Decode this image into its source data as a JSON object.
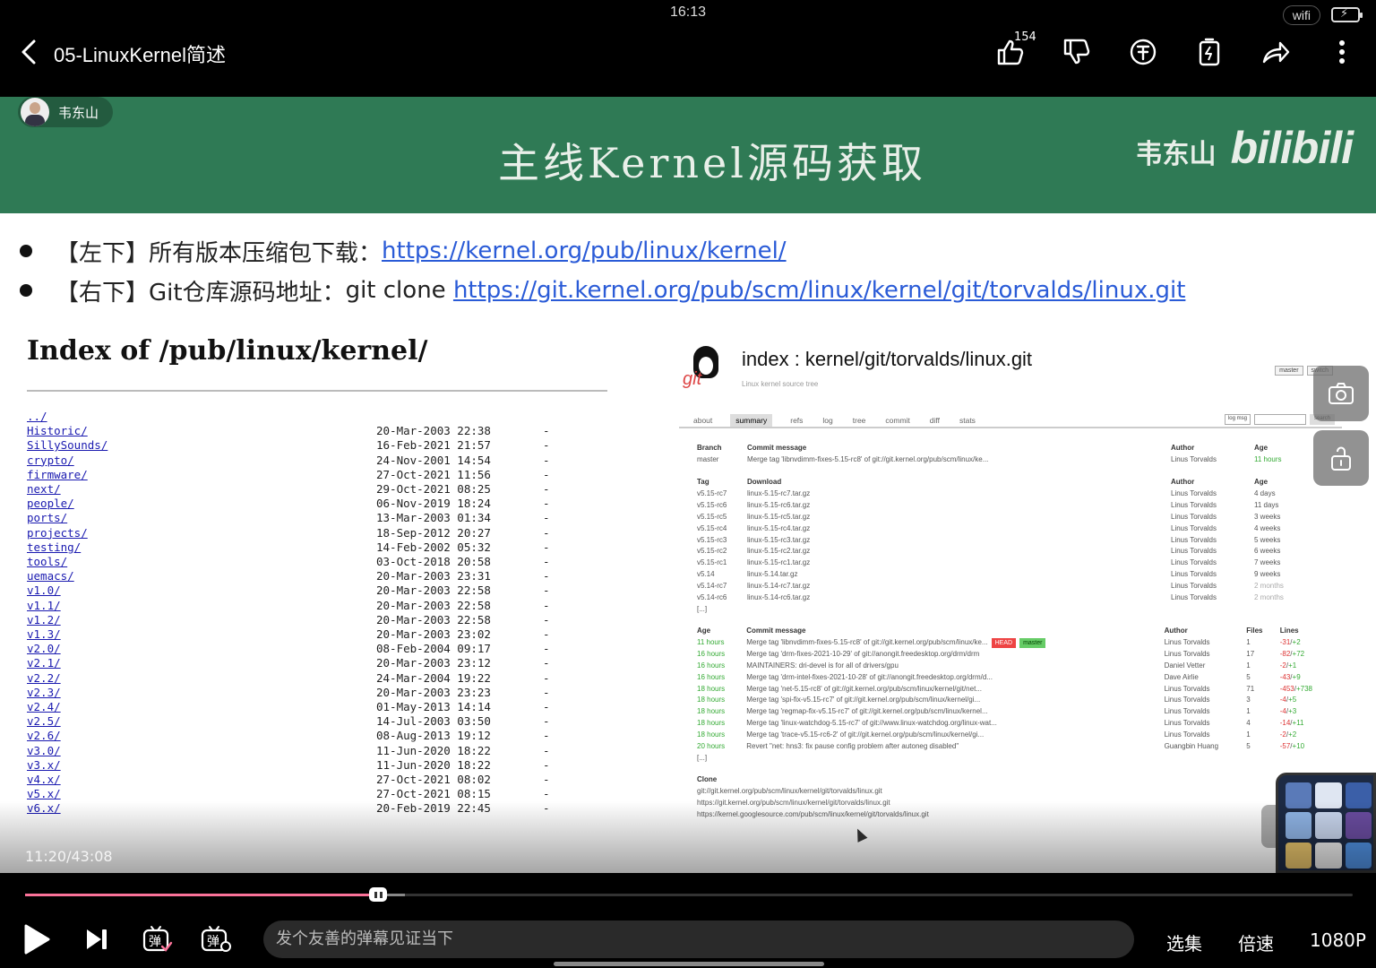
{
  "status_bar": {
    "time": "16:13",
    "wifi": "wifi",
    "battery": "⚡"
  },
  "header": {
    "title": "05-LinuxKernel简述",
    "like_count": "154"
  },
  "slide": {
    "author": "韦东山",
    "title": "主线Kernel源码获取",
    "brand_name": "韦东山",
    "brand_logo": "bilibili",
    "bullets": [
      {
        "label": "【左下】所有版本压缩包下载：",
        "prefix": "",
        "link": "https://kernel.org/pub/linux/kernel/"
      },
      {
        "label": "【右下】Git仓库源码地址：",
        "prefix": "git clone ",
        "link": "https://git.kernel.org/pub/scm/linux/kernel/git/torvalds/linux.git"
      }
    ],
    "index": {
      "title": "Index of /pub/linux/kernel/",
      "rows": [
        {
          "name": "../",
          "date": "",
          "size": ""
        },
        {
          "name": "Historic/",
          "date": "20-Mar-2003 22:38",
          "size": "-"
        },
        {
          "name": "SillySounds/",
          "date": "16-Feb-2021 21:57",
          "size": "-"
        },
        {
          "name": "crypto/",
          "date": "24-Nov-2001 14:54",
          "size": "-"
        },
        {
          "name": "firmware/",
          "date": "27-Oct-2021 11:56",
          "size": "-"
        },
        {
          "name": "next/",
          "date": "29-Oct-2021 08:25",
          "size": "-"
        },
        {
          "name": "people/",
          "date": "06-Nov-2019 18:24",
          "size": "-"
        },
        {
          "name": "ports/",
          "date": "13-Mar-2003 01:34",
          "size": "-"
        },
        {
          "name": "projects/",
          "date": "18-Sep-2012 20:27",
          "size": "-"
        },
        {
          "name": "testing/",
          "date": "14-Feb-2002 05:32",
          "size": "-"
        },
        {
          "name": "tools/",
          "date": "03-Oct-2018 20:58",
          "size": "-"
        },
        {
          "name": "uemacs/",
          "date": "20-Mar-2003 23:31",
          "size": "-"
        },
        {
          "name": "v1.0/",
          "date": "20-Mar-2003 22:58",
          "size": "-"
        },
        {
          "name": "v1.1/",
          "date": "20-Mar-2003 22:58",
          "size": "-"
        },
        {
          "name": "v1.2/",
          "date": "20-Mar-2003 22:58",
          "size": "-"
        },
        {
          "name": "v1.3/",
          "date": "20-Mar-2003 23:02",
          "size": "-"
        },
        {
          "name": "v2.0/",
          "date": "08-Feb-2004 09:17",
          "size": "-"
        },
        {
          "name": "v2.1/",
          "date": "20-Mar-2003 23:12",
          "size": "-"
        },
        {
          "name": "v2.2/",
          "date": "24-Mar-2004 19:22",
          "size": "-"
        },
        {
          "name": "v2.3/",
          "date": "20-Mar-2003 23:23",
          "size": "-"
        },
        {
          "name": "v2.4/",
          "date": "01-May-2013 14:14",
          "size": "-"
        },
        {
          "name": "v2.5/",
          "date": "14-Jul-2003 03:50",
          "size": "-"
        },
        {
          "name": "v2.6/",
          "date": "08-Aug-2013 19:12",
          "size": "-"
        },
        {
          "name": "v3.0/",
          "date": "11-Jun-2020 18:22",
          "size": "-"
        },
        {
          "name": "v3.x/",
          "date": "11-Jun-2020 18:22",
          "size": "-"
        },
        {
          "name": "v4.x/",
          "date": "27-Oct-2021 08:02",
          "size": "-"
        },
        {
          "name": "v5.x/",
          "date": "27-Oct-2021 08:15",
          "size": "-"
        },
        {
          "name": "v6.x/",
          "date": "20-Feb-2019 22:45",
          "size": "-"
        }
      ]
    },
    "git": {
      "logo_text": "git",
      "title": "index : kernel/git/torvalds/linux.git",
      "description": "Linux kernel source tree",
      "branch_select": "master",
      "switch_label": "switch",
      "side_text": "Linus To",
      "tabs": [
        "about",
        "summary",
        "refs",
        "log",
        "tree",
        "commit",
        "diff",
        "stats"
      ],
      "active_tab": "summary",
      "search_select": "log msg",
      "search_label": "search",
      "branch_header": [
        "Branch",
        "Commit message",
        "Author",
        "Age"
      ],
      "branch_rows": [
        {
          "name": "master",
          "message": "Merge tag 'libnvdimm-fixes-5.15-rc8' of git://git.kernel.org/pub/scm/linux/ke...",
          "author": "Linus Torvalds",
          "age": "11 hours"
        }
      ],
      "tag_header": [
        "Tag",
        "Download",
        "Author",
        "Age"
      ],
      "tag_rows": [
        {
          "tag": "v5.15-rc7",
          "download": "linux-5.15-rc7.tar.gz",
          "author": "Linus Torvalds",
          "age": "4 days"
        },
        {
          "tag": "v5.15-rc6",
          "download": "linux-5.15-rc6.tar.gz",
          "author": "Linus Torvalds",
          "age": "11 days"
        },
        {
          "tag": "v5.15-rc5",
          "download": "linux-5.15-rc5.tar.gz",
          "author": "Linus Torvalds",
          "age": "3 weeks"
        },
        {
          "tag": "v5.15-rc4",
          "download": "linux-5.15-rc4.tar.gz",
          "author": "Linus Torvalds",
          "age": "4 weeks"
        },
        {
          "tag": "v5.15-rc3",
          "download": "linux-5.15-rc3.tar.gz",
          "author": "Linus Torvalds",
          "age": "5 weeks"
        },
        {
          "tag": "v5.15-rc2",
          "download": "linux-5.15-rc2.tar.gz",
          "author": "Linus Torvalds",
          "age": "6 weeks"
        },
        {
          "tag": "v5.15-rc1",
          "download": "linux-5.15-rc1.tar.gz",
          "author": "Linus Torvalds",
          "age": "7 weeks"
        },
        {
          "tag": "v5.14",
          "download": "linux-5.14.tar.gz",
          "author": "Linus Torvalds",
          "age": "9 weeks"
        },
        {
          "tag": "v5.14-rc7",
          "download": "linux-5.14-rc7.tar.gz",
          "author": "Linus Torvalds",
          "age": "2 months"
        },
        {
          "tag": "v5.14-rc6",
          "download": "linux-5.14-rc6.tar.gz",
          "author": "Linus Torvalds",
          "age": "2 months"
        }
      ],
      "more": "[...]",
      "commit_header": [
        "Age",
        "Commit message",
        "Author",
        "Files",
        "Lines"
      ],
      "commit_rows": [
        {
          "age": "11 hours",
          "message": "Merge tag 'libnvdimm-fixes-5.15-rc8' of git://git.kernel.org/pub/scm/linux/ke...",
          "head": "HEAD",
          "branch": "master",
          "author": "Linus Torvalds",
          "files": "1",
          "del": "-31",
          "add": "+2"
        },
        {
          "age": "16 hours",
          "message": "Merge tag 'drm-fixes-2021-10-29' of git://anongit.freedesktop.org/drm/drm",
          "head": "",
          "branch": "",
          "author": "Linus Torvalds",
          "files": "17",
          "del": "-82",
          "add": "+72"
        },
        {
          "age": "16 hours",
          "message": "MAINTAINERS: dri-devel is for all of drivers/gpu",
          "head": "",
          "branch": "",
          "author": "Daniel Vetter",
          "files": "1",
          "del": "-2",
          "add": "+1"
        },
        {
          "age": "16 hours",
          "message": "Merge tag 'drm-intel-fixes-2021-10-28' of git://anongit.freedesktop.org/drm/d...",
          "head": "",
          "branch": "",
          "author": "Dave Airlie",
          "files": "5",
          "del": "-43",
          "add": "+9"
        },
        {
          "age": "18 hours",
          "message": "Merge tag 'net-5.15-rc8' of git://git.kernel.org/pub/scm/linux/kernel/git/net...",
          "head": "",
          "branch": "",
          "author": "Linus Torvalds",
          "files": "71",
          "del": "-453",
          "add": "+738"
        },
        {
          "age": "18 hours",
          "message": "Merge tag 'spi-fix-v5.15-rc7' of git://git.kernel.org/pub/scm/linux/kernel/gi...",
          "head": "",
          "branch": "",
          "author": "Linus Torvalds",
          "files": "3",
          "del": "-4",
          "add": "+5"
        },
        {
          "age": "18 hours",
          "message": "Merge tag 'regmap-fix-v5.15-rc7' of git://git.kernel.org/pub/scm/linux/kernel...",
          "head": "",
          "branch": "",
          "author": "Linus Torvalds",
          "files": "1",
          "del": "-4",
          "add": "+3"
        },
        {
          "age": "18 hours",
          "message": "Merge tag 'linux-watchdog-5.15-rc7' of git://www.linux-watchdog.org/linux-wat...",
          "head": "",
          "branch": "",
          "author": "Linus Torvalds",
          "files": "4",
          "del": "-14",
          "add": "+11"
        },
        {
          "age": "18 hours",
          "message": "Merge tag 'trace-v5.15-rc6-2' of git://git.kernel.org/pub/scm/linux/kernel/gi...",
          "head": "",
          "branch": "",
          "author": "Linus Torvalds",
          "files": "1",
          "del": "-2",
          "add": "+2"
        },
        {
          "age": "20 hours",
          "message": "Revert \"net: hns3: fix pause config problem after autoneg disabled\"",
          "head": "",
          "branch": "",
          "author": "Guangbin Huang",
          "files": "5",
          "del": "-57",
          "add": "+10"
        }
      ],
      "clone_header": "Clone",
      "clone_urls": [
        "git://git.kernel.org/pub/scm/linux/kernel/git/torvalds/linux.git",
        "https://git.kernel.org/pub/scm/linux/kernel/git/torvalds/linux.git",
        "https://kernel.googlesource.com/pub/scm/linux/kernel/git/torvalds/linux.git"
      ]
    }
  },
  "player": {
    "timestamp": "11:20/43:08",
    "progress": 0.266,
    "buffered": 0.286,
    "danmaku_placeholder": "发个友善的弹幕见证当下",
    "episodes_label": "选集",
    "speed_label": "倍速",
    "quality_label": "1080P",
    "accent_color": "#fb7299"
  }
}
